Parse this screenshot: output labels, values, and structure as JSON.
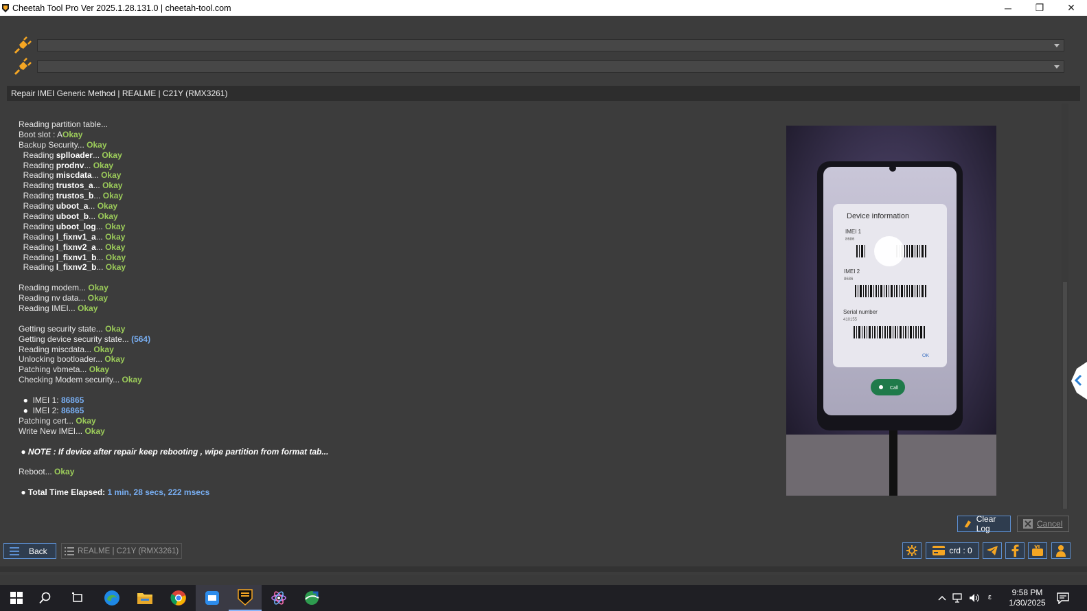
{
  "window": {
    "title": "Cheetah Tool Pro Ver 2025.1.28.131.0 | cheetah-tool.com",
    "minimize": "─",
    "maximize": "❐",
    "close": "✕"
  },
  "ports": [
    {
      "value": ""
    },
    {
      "value": ""
    }
  ],
  "operation_title": "Repair IMEI Generic Method | REALME | C21Y (RMX3261)",
  "log": {
    "l1": "Reading partition table...",
    "l2a": "Boot slot : A",
    "l2b": "Okay",
    "l3a": "Backup Security... ",
    "l3b": "Okay",
    "parts": [
      {
        "name": "splloader",
        "status": "Okay"
      },
      {
        "name": "prodnv",
        "status": "Okay"
      },
      {
        "name": "miscdata",
        "status": "Okay"
      },
      {
        "name": "trustos_a",
        "status": "Okay"
      },
      {
        "name": "trustos_b",
        "status": "Okay"
      },
      {
        "name": "uboot_a",
        "status": "Okay"
      },
      {
        "name": "uboot_b",
        "status": "Okay"
      },
      {
        "name": "uboot_log",
        "status": "Okay"
      },
      {
        "name": "l_fixnv1_a",
        "status": "Okay"
      },
      {
        "name": "l_fixnv2_a",
        "status": "Okay"
      },
      {
        "name": "l_fixnv1_b",
        "status": "Okay"
      },
      {
        "name": "l_fixnv2_b",
        "status": "Okay"
      }
    ],
    "reading_prefix": "  Reading ",
    "dots": "... ",
    "modem": "Reading modem... ",
    "modem_s": "Okay",
    "nv": "Reading nv data... ",
    "nv_s": "Okay",
    "imei": "Reading IMEI... ",
    "imei_s": "Okay",
    "sec": "Getting security state... ",
    "sec_s": "Okay",
    "devsec": "Getting device security state... ",
    "devsec_s": "(564)",
    "misc": "Reading miscdata... ",
    "misc_s": "Okay",
    "unlock": "Unlocking bootloader... ",
    "unlock_s": "Okay",
    "vbmeta": "Patching vbmeta... ",
    "vbmeta_s": "Okay",
    "modemsec": "Checking Modem security... ",
    "modemsec_s": "Okay",
    "imei1_label": "IMEI 1: ",
    "imei1_value": "86865",
    "imei2_label": "IMEI 2: ",
    "imei2_value": "86865",
    "cert": "Patching cert... ",
    "cert_s": "Okay",
    "write": "Write New IMEI... ",
    "write_s": "Okay",
    "note": "NOTE : If device after repair keep rebooting , wipe partition from format tab...",
    "reboot": "Reboot... ",
    "reboot_s": "Okay",
    "elapsed_label": "Total Time Elapsed: ",
    "elapsed_value": "1 min, 28 secs, 222 msecs"
  },
  "phone_screen": {
    "dialog_title": "Device information",
    "imei1": "IMEI 1",
    "imei1_val": "8686",
    "imei2": "IMEI 2",
    "imei2_val": "8686",
    "serial": "Serial number",
    "serial_val": "410155",
    "ok": "OK",
    "call": "Call"
  },
  "buttons": {
    "clear_log": "Clear Log",
    "cancel": "Cancel",
    "back": "Back",
    "model_tab": "REALME | C21Y (RMX3261)",
    "credits": "crd : 0"
  },
  "taskbar": {
    "time": "9:58 PM",
    "date": "1/30/2025"
  },
  "colors": {
    "ok": "#9ccc5a",
    "value": "#78aef2",
    "accent": "#f5a623",
    "button_border": "#5d8fd0"
  }
}
